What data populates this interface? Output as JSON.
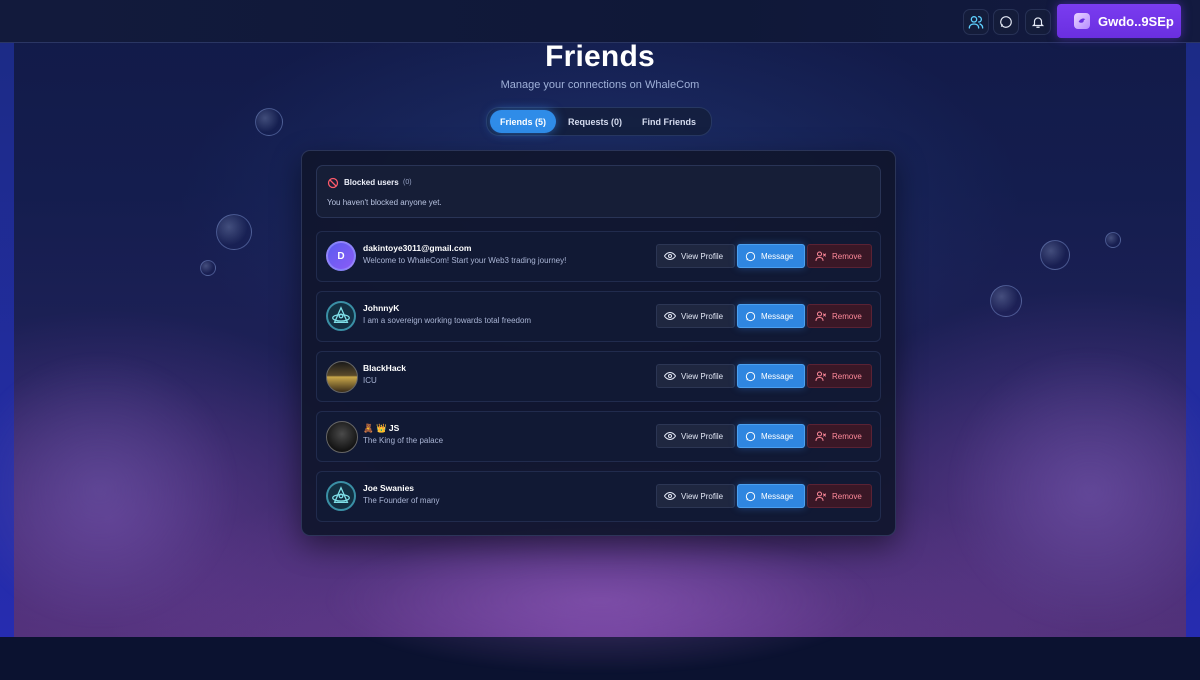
{
  "header": {
    "wallet_label": "Gwdo..9SEp",
    "icons": [
      "users-icon",
      "chat-icon",
      "bell-icon"
    ]
  },
  "page": {
    "title": "Friends",
    "subtitle": "Manage your connections on WhaleCom"
  },
  "tabs": [
    {
      "label": "Friends (5)",
      "active": true
    },
    {
      "label": "Requests (0)",
      "active": false
    },
    {
      "label": "Find Friends",
      "active": false
    }
  ],
  "blocked": {
    "title": "Blocked users",
    "count": "(0)",
    "empty_text": "You haven't blocked anyone yet."
  },
  "buttons": {
    "view_profile": "View Profile",
    "message": "Message",
    "remove": "Remove"
  },
  "friends": [
    {
      "name": "dakintoye3011@gmail.com",
      "status": "Welcome to WhaleCom! Start your Web3 trading journey!",
      "avatar": "D"
    },
    {
      "name": "JohnnyK",
      "status": "I am a sovereign working towards total freedom",
      "avatar": "whale-logo"
    },
    {
      "name": "BlackHack",
      "status": "ICU",
      "avatar": "photo"
    },
    {
      "name": "🧸 👑 JS",
      "status": "The King of the palace",
      "avatar": "photo"
    },
    {
      "name": "Joe Swanies",
      "status": "The Founder of many",
      "avatar": "whale-logo"
    }
  ],
  "colors": {
    "accent": "#2f86e0",
    "wallet": "#6a2fe0",
    "remove": "#ff8a9a"
  }
}
